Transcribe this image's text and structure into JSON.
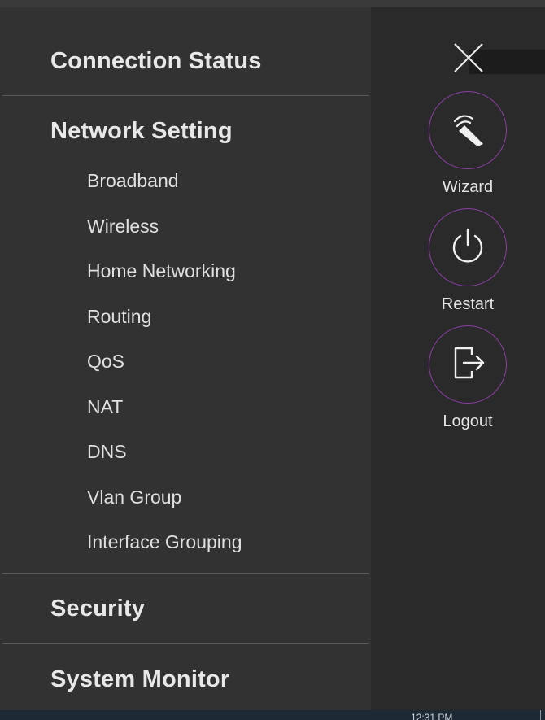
{
  "menu": {
    "connection_status": "Connection Status",
    "network_setting": {
      "label": "Network Setting",
      "items": [
        "Broadband",
        "Wireless",
        "Home Networking",
        "Routing",
        "QoS",
        "NAT",
        "DNS",
        "Vlan Group",
        "Interface Grouping"
      ]
    },
    "security": "Security",
    "system_monitor": "System Monitor"
  },
  "actions": {
    "wizard": "Wizard",
    "restart": "Restart",
    "logout": "Logout"
  },
  "taskbar": {
    "clock": "12:31 PM"
  },
  "colors": {
    "accent_ring": "#8a3fa0",
    "panel": "#323232",
    "background": "#2a2a2a"
  },
  "icons": {
    "close": "close-icon",
    "wizard": "wand-icon",
    "restart": "power-icon",
    "logout": "logout-icon"
  }
}
